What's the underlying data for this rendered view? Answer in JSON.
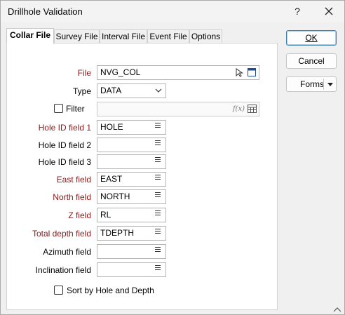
{
  "window": {
    "title": "Drillhole Validation",
    "help_label": "?"
  },
  "tabs": [
    {
      "label": "Collar File",
      "active": true
    },
    {
      "label": "Survey File",
      "active": false
    },
    {
      "label": "Interval File",
      "active": false
    },
    {
      "label": "Event File",
      "active": false
    },
    {
      "label": "Options",
      "active": false
    }
  ],
  "form": {
    "file": {
      "label": "File",
      "value": "NVG_COL"
    },
    "type": {
      "label": "Type",
      "value": "DATA"
    },
    "filter": {
      "label": "Filter",
      "checked": false,
      "value": "",
      "fx_label": "f(x)"
    },
    "hole_id_1": {
      "label": "Hole ID field 1",
      "value": "HOLE"
    },
    "hole_id_2": {
      "label": "Hole ID field 2",
      "value": ""
    },
    "hole_id_3": {
      "label": "Hole ID field 3",
      "value": ""
    },
    "east": {
      "label": "East field",
      "value": "EAST"
    },
    "north": {
      "label": "North field",
      "value": "NORTH"
    },
    "z": {
      "label": "Z field",
      "value": "RL"
    },
    "total_depth": {
      "label": "Total depth field",
      "value": "TDEPTH"
    },
    "azimuth": {
      "label": "Azimuth field",
      "value": ""
    },
    "inclination": {
      "label": "Inclination field",
      "value": ""
    },
    "sort": {
      "label": "Sort by Hole and Depth",
      "checked": false
    }
  },
  "buttons": {
    "ok": "OK",
    "cancel": "Cancel",
    "forms": "Forms"
  },
  "colors": {
    "required_label": "#8b1a1a",
    "default_button_border": "#3c7fb1"
  }
}
